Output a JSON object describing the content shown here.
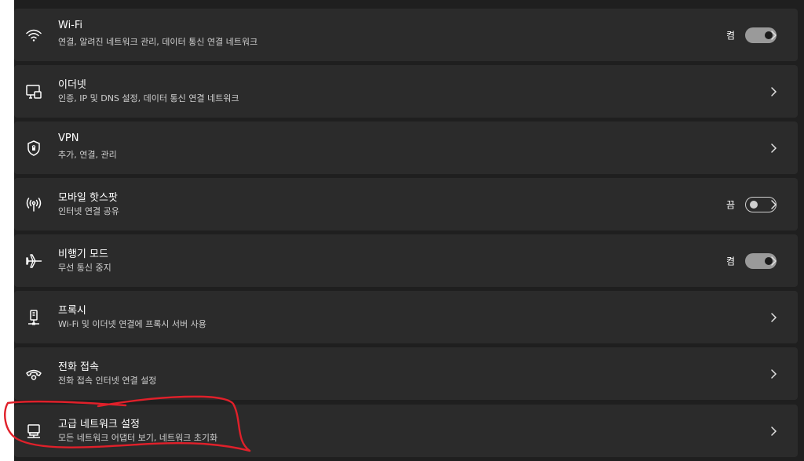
{
  "items": [
    {
      "title": "Wi-Fi",
      "subtitle": "연결, 알려진 네트워크 관리, 데이터 통신 연결 네트워크",
      "state": "켬"
    },
    {
      "title": "이더넷",
      "subtitle": "인증, IP 및 DNS 설정, 데이터 통신 연결 네트워크"
    },
    {
      "title": "VPN",
      "subtitle": "추가, 연결, 관리"
    },
    {
      "title": "모바일 핫스팟",
      "subtitle": "인터넷 연결 공유",
      "state": "끔"
    },
    {
      "title": "비행기 모드",
      "subtitle": "무선 통신 중지",
      "state": "켬"
    },
    {
      "title": "프록시",
      "subtitle": "Wi-Fi 및 이더넷 연결에 프록시 서버 사용"
    },
    {
      "title": "전화 접속",
      "subtitle": "전화 접속 인터넷 연결 설정"
    },
    {
      "title": "고급 네트워크 설정",
      "subtitle": "모든 네트워크 어댑터 보기, 네트워크 초기화"
    }
  ],
  "icons": {
    "wifi": "wifi-icon",
    "ethernet": "ethernet-icon",
    "vpn": "shield-icon",
    "hotspot": "hotspot-icon",
    "airplane": "airplane-icon",
    "proxy": "proxy-icon",
    "dialup": "phone-icon",
    "advanced": "network-adapter-icon"
  },
  "toggles": {
    "wifi": true,
    "hotspot": false,
    "airplane": true
  },
  "colors": {
    "background": "#1f1f1f",
    "card": "#2b2b2b",
    "toggle_on": "#9a9a9a",
    "annotation": "#e0202a"
  }
}
